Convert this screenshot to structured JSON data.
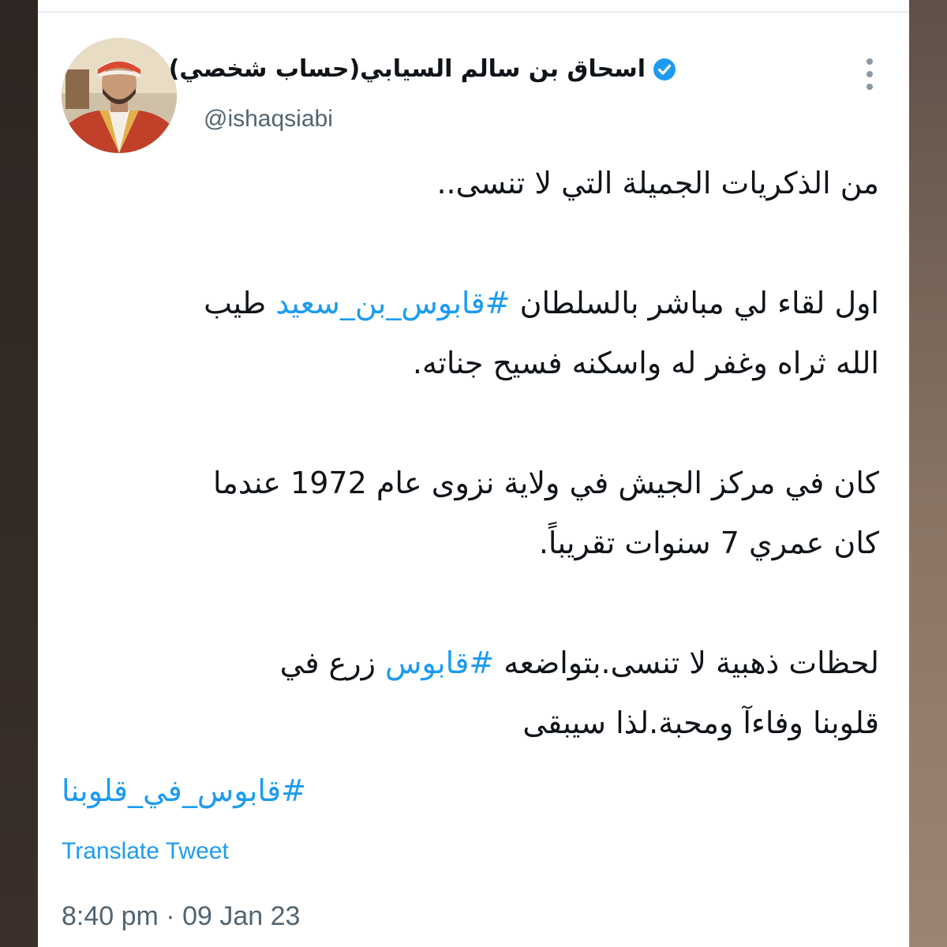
{
  "tweet": {
    "author_name": "اسحاق بن سالم السيابي(حساب شخصي)",
    "handle": "@ishaqsiabi",
    "verified_icon": "verified-badge-icon",
    "more_icon": "more-vertical-icon",
    "line1": "من الذكريات الجميلة التي لا تنسى..",
    "p2a_before": "اول لقاء لي مباشر بالسلطان ",
    "p2a_hashtag": "#قابوس_بن_سعيد",
    "p2a_after": " طيب",
    "p2b": "الله ثراه وغفر له واسكنه فسيح جناته.",
    "p3a": "كان في مركز الجيش في ولاية نزوى عام 1972 عندما",
    "p3b": "كان عمري 7 سنوات تقريباً.",
    "p4a_before": "لحظات ذهبية لا تنسى.بتواضعه ",
    "p4a_hashtag": "#قابوس",
    "p4a_after": " زرع في",
    "p4b": "قلوبنا وفاءآ ومحبة.لذا سيبقى",
    "hashtag_final": "#قابوس_في_قلوبنا",
    "translate_label": "Translate Tweet",
    "timestamp": "8:40 pm · 09 Jan 23"
  },
  "colors": {
    "link": "#1d9bf0",
    "text": "#0f1419",
    "secondary": "#536471"
  }
}
